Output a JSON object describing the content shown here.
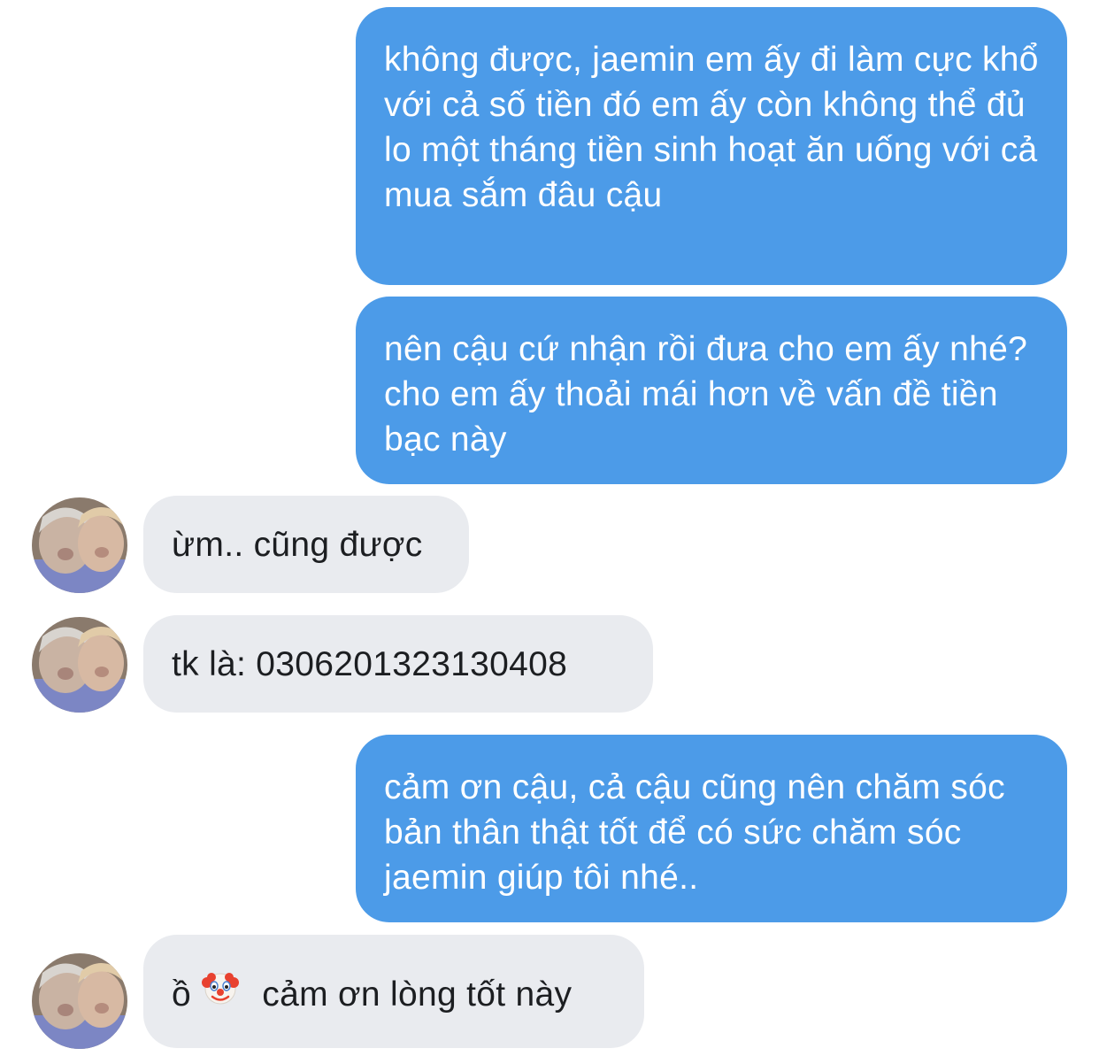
{
  "messages": [
    {
      "direction": "sent",
      "text": "không được, jaemin em ấy đi làm cực khổ với cả số tiền đó em ấy còn không thể đủ lo một tháng tiền sinh hoạt ăn uống với cả mua sắm đâu cậu"
    },
    {
      "direction": "sent",
      "text": "nên cậu cứ nhận rồi đưa cho em ấy nhé? cho em ấy thoải mái hơn về vấn đề tiền bạc này"
    },
    {
      "direction": "received",
      "text": "ừm.. cũng được",
      "avatar": "contact-avatar"
    },
    {
      "direction": "received",
      "text": "tk là: 0306201323130408",
      "avatar": "contact-avatar"
    },
    {
      "direction": "sent",
      "text": "cảm ơn cậu, cả cậu cũng nên chăm sóc bản thân thật tốt để có sức chăm sóc jaemin giúp tôi nhé.."
    },
    {
      "direction": "received",
      "text_before": "ồ",
      "emoji": "clown-face-emoji",
      "text_after": "cảm ơn lòng tốt này",
      "avatar": "contact-avatar"
    }
  ],
  "colors": {
    "sent_bubble": "#4c9be8",
    "sent_text": "#ffffff",
    "received_bubble": "#e9ebef",
    "received_text": "#1c1e21",
    "background": "#ffffff"
  }
}
